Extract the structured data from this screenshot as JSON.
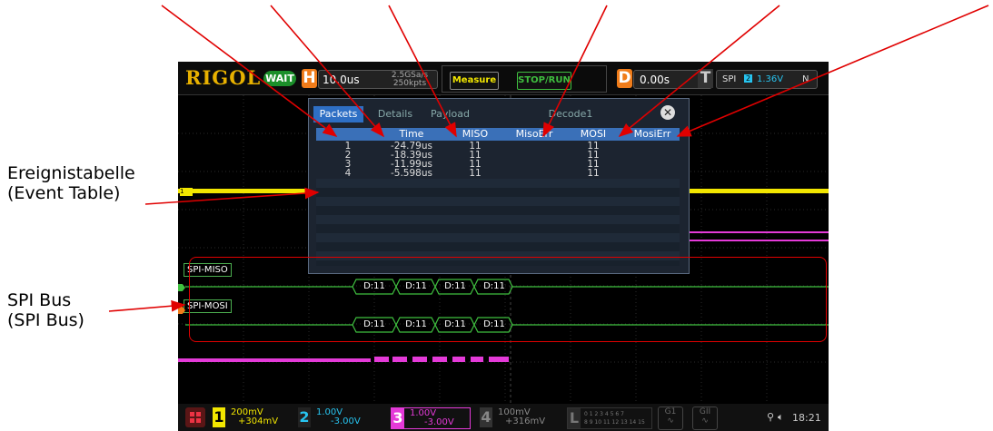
{
  "annotations": {
    "event_table": {
      "line1": "Ereignistabelle",
      "line2": "(Event Table)"
    },
    "spi_bus": {
      "line1": "SPI  Bus",
      "line2": "(SPI  Bus)"
    }
  },
  "topbar": {
    "logo": "RIGOL",
    "status": "WAIT",
    "h_label": "H",
    "timebase": "10.0us",
    "sample_rate": "2.5GSa/s",
    "memory_depth": "250kpts",
    "measure_button": "Measure",
    "stoprun_button": "STOP/RUN",
    "d_label": "D",
    "delay": "0.00s",
    "t_label": "T",
    "trigger_type": "SPI",
    "trigger_level": "1.36V",
    "trigger_mode": "N"
  },
  "event_table": {
    "tabs": [
      "Packets",
      "Details",
      "Payload",
      "Decode1"
    ],
    "columns": [
      "",
      "Time",
      "MISO",
      "MisoErr",
      "MOSI",
      "MosiErr"
    ],
    "rows": [
      [
        "1",
        "-24.79us",
        "11",
        "",
        "11",
        ""
      ],
      [
        "2",
        "-18.39us",
        "11",
        "",
        "11",
        ""
      ],
      [
        "3",
        "-11.99us",
        "11",
        "",
        "11",
        ""
      ],
      [
        "4",
        "-5.598us",
        "11",
        "",
        "11",
        ""
      ]
    ]
  },
  "buses": {
    "miso_label": "SPI-MISO",
    "mosi_label": "SPI-MOSI",
    "miso_packets": [
      "D:11",
      "D:11",
      "D:11",
      "D:11"
    ],
    "mosi_packets": [
      "D:11",
      "D:11",
      "D:11",
      "D:11"
    ]
  },
  "channels": [
    {
      "num": "1",
      "scale": "200mV",
      "offset": "+304mV",
      "color": "#f2e600"
    },
    {
      "num": "2",
      "scale": "1.00V",
      "offset": "-3.00V",
      "color": "#27c4f0"
    },
    {
      "num": "3",
      "scale": "1.00V",
      "offset": "-3.00V",
      "color": "#e43ad8"
    },
    {
      "num": "4",
      "scale": "100mV",
      "offset": "+316mV",
      "color": "#777777"
    }
  ],
  "logic_label": "L",
  "logic_bits_top": "0 1 2 3  4 5 6 7",
  "logic_bits_bottom": "8 9 10 11 12 13 14 15",
  "status_time": "18:21",
  "colors": {
    "ch1": "#f2e600",
    "ch3": "#e43ad8",
    "bus": "#3fbf3f",
    "annotation_arrow": "#e00000",
    "accent": "#f07c1a"
  }
}
